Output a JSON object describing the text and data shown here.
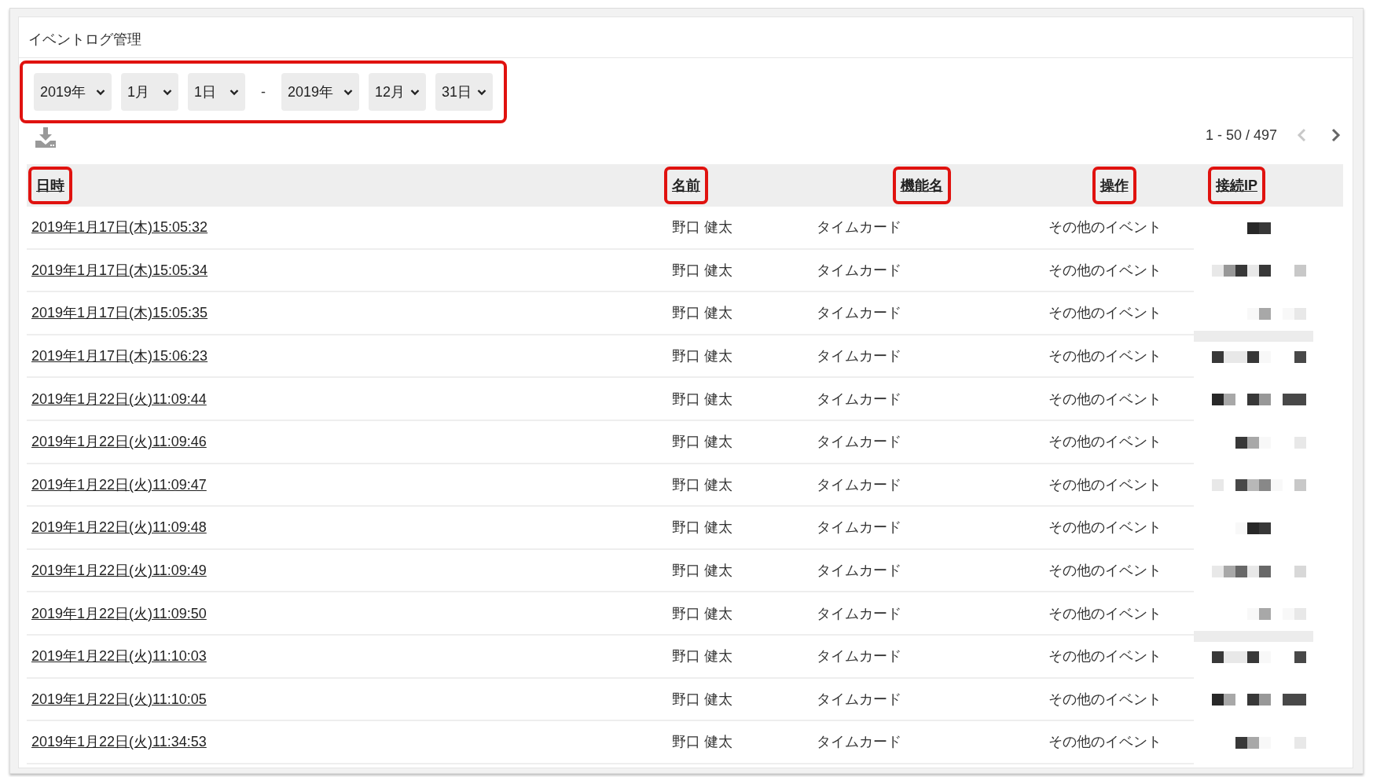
{
  "panel": {
    "title": "イベントログ管理"
  },
  "date_range": {
    "highlighted": true,
    "separator": "-",
    "from": [
      {
        "kind": "year",
        "value": "2019年"
      },
      {
        "kind": "month",
        "value": "1月"
      },
      {
        "kind": "day",
        "value": "1日"
      }
    ],
    "to": [
      {
        "kind": "year",
        "value": "2019年"
      },
      {
        "kind": "month",
        "value": "12月"
      },
      {
        "kind": "day",
        "value": "31日"
      }
    ]
  },
  "pagination": {
    "range": "1 - 50 / 497",
    "prev_disabled": true,
    "next_disabled": false
  },
  "table": {
    "columns": [
      {
        "label": "日時",
        "highlighted": true
      },
      {
        "label": "名前",
        "highlighted": true
      },
      {
        "label": "機能名",
        "highlighted": true
      },
      {
        "label": "操作",
        "highlighted": true
      },
      {
        "label": "接続IP",
        "highlighted": true
      }
    ],
    "rows": [
      {
        "datetime": "2019年1月17日(木)15:05:32",
        "name": "野口 健太",
        "function": "タイムカード",
        "operation": "その他のイベント"
      },
      {
        "datetime": "2019年1月17日(木)15:05:34",
        "name": "野口 健太",
        "function": "タイムカード",
        "operation": "その他のイベント"
      },
      {
        "datetime": "2019年1月17日(木)15:05:35",
        "name": "野口 健太",
        "function": "タイムカード",
        "operation": "その他のイベント"
      },
      {
        "datetime": "2019年1月17日(木)15:06:23",
        "name": "野口 健太",
        "function": "タイムカード",
        "operation": "その他のイベント"
      },
      {
        "datetime": "2019年1月22日(火)11:09:44",
        "name": "野口 健太",
        "function": "タイムカード",
        "operation": "その他のイベント"
      },
      {
        "datetime": "2019年1月22日(火)11:09:46",
        "name": "野口 健太",
        "function": "タイムカード",
        "operation": "その他のイベント"
      },
      {
        "datetime": "2019年1月22日(火)11:09:47",
        "name": "野口 健太",
        "function": "タイムカード",
        "operation": "その他のイベント"
      },
      {
        "datetime": "2019年1月22日(火)11:09:48",
        "name": "野口 健太",
        "function": "タイムカード",
        "operation": "その他のイベント"
      },
      {
        "datetime": "2019年1月22日(火)11:09:49",
        "name": "野口 健太",
        "function": "タイムカード",
        "operation": "その他のイベント"
      },
      {
        "datetime": "2019年1月22日(火)11:09:50",
        "name": "野口 健太",
        "function": "タイムカード",
        "operation": "その他のイベント"
      },
      {
        "datetime": "2019年1月22日(火)11:10:03",
        "name": "野口 健太",
        "function": "タイムカード",
        "operation": "その他のイベント"
      },
      {
        "datetime": "2019年1月22日(火)11:10:05",
        "name": "野口 健太",
        "function": "タイムカード",
        "operation": "その他のイベント"
      },
      {
        "datetime": "2019年1月22日(火)11:34:53",
        "name": "野口 健太",
        "function": "タイムカード",
        "operation": "その他のイベント"
      }
    ]
  }
}
